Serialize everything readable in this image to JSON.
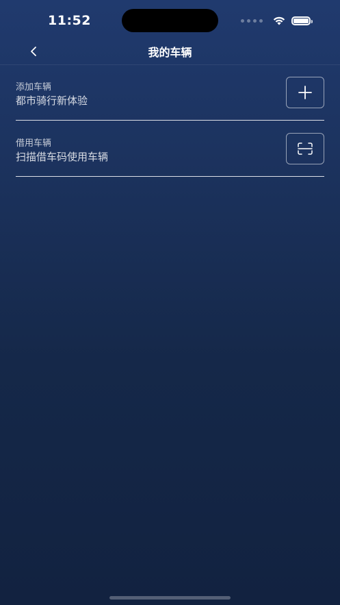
{
  "status_bar": {
    "time": "11:52",
    "icons": [
      "cellular-signal-icon",
      "wifi-icon",
      "battery-icon"
    ],
    "battery_level": 1.0
  },
  "nav": {
    "back_icon": "chevron-left-icon",
    "title": "我的车辆"
  },
  "rows": [
    {
      "label": "添加车辆",
      "description": "都市骑行新体验",
      "action_icon": "plus-icon"
    },
    {
      "label": "借用车辆",
      "description": "扫描借车码使用车辆",
      "action_icon": "scan-icon"
    }
  ],
  "colors": {
    "background_top": "#203a6e",
    "background_bottom": "#122240",
    "text": "#ffffff"
  }
}
